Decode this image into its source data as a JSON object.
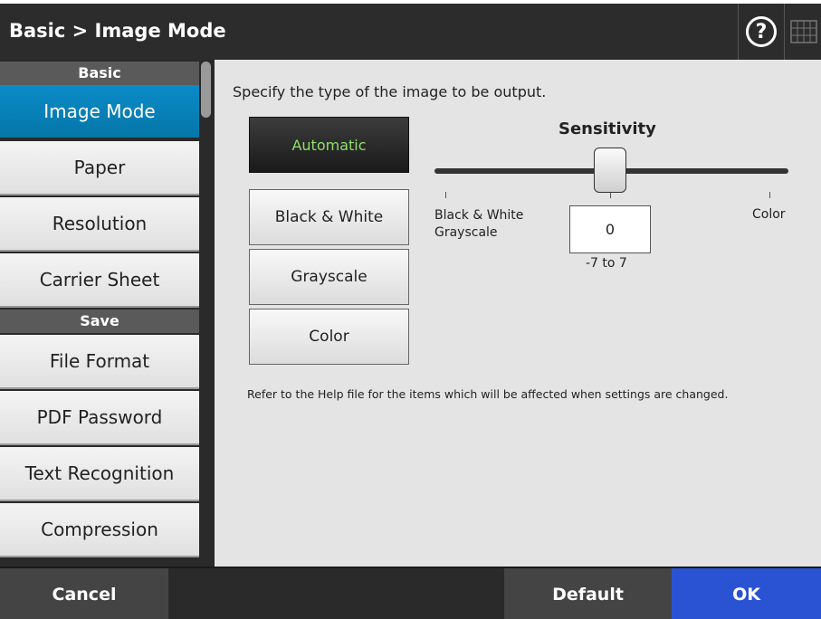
{
  "header": {
    "title": "Basic > Image Mode",
    "help_glyph": "?"
  },
  "sidebar": {
    "sections": [
      {
        "label": "Basic"
      },
      {
        "label": "Save"
      }
    ],
    "items": [
      {
        "label": "Image Mode",
        "active": true
      },
      {
        "label": "Paper"
      },
      {
        "label": "Resolution"
      },
      {
        "label": "Carrier Sheet"
      },
      {
        "label": "File Format"
      },
      {
        "label": "PDF Password"
      },
      {
        "label": "Text Recognition"
      },
      {
        "label": "Compression"
      }
    ]
  },
  "main": {
    "instruction": "Specify the type of the image to be output.",
    "modes": [
      {
        "label": "Automatic",
        "selected": true
      },
      {
        "label": "Black & White"
      },
      {
        "label": "Grayscale"
      },
      {
        "label": "Color"
      }
    ],
    "sensitivity": {
      "title": "Sensitivity",
      "min_label_line1": "Black & White",
      "min_label_line2": "Grayscale",
      "max_label": "Color",
      "value": "0",
      "range_text": "-7 to 7"
    },
    "note": "Refer to the Help file for the items which will be affected when settings are changed."
  },
  "footer": {
    "cancel_label": "Cancel",
    "default_label": "Default",
    "ok_label": "OK"
  },
  "colors": {
    "active_item": "#0a8bc8",
    "ok_button": "#2a53d4",
    "automatic_text": "#8ddf6a"
  },
  "icons": {
    "help": "question-circle-icon",
    "keyboard": "keyboard-icon"
  }
}
